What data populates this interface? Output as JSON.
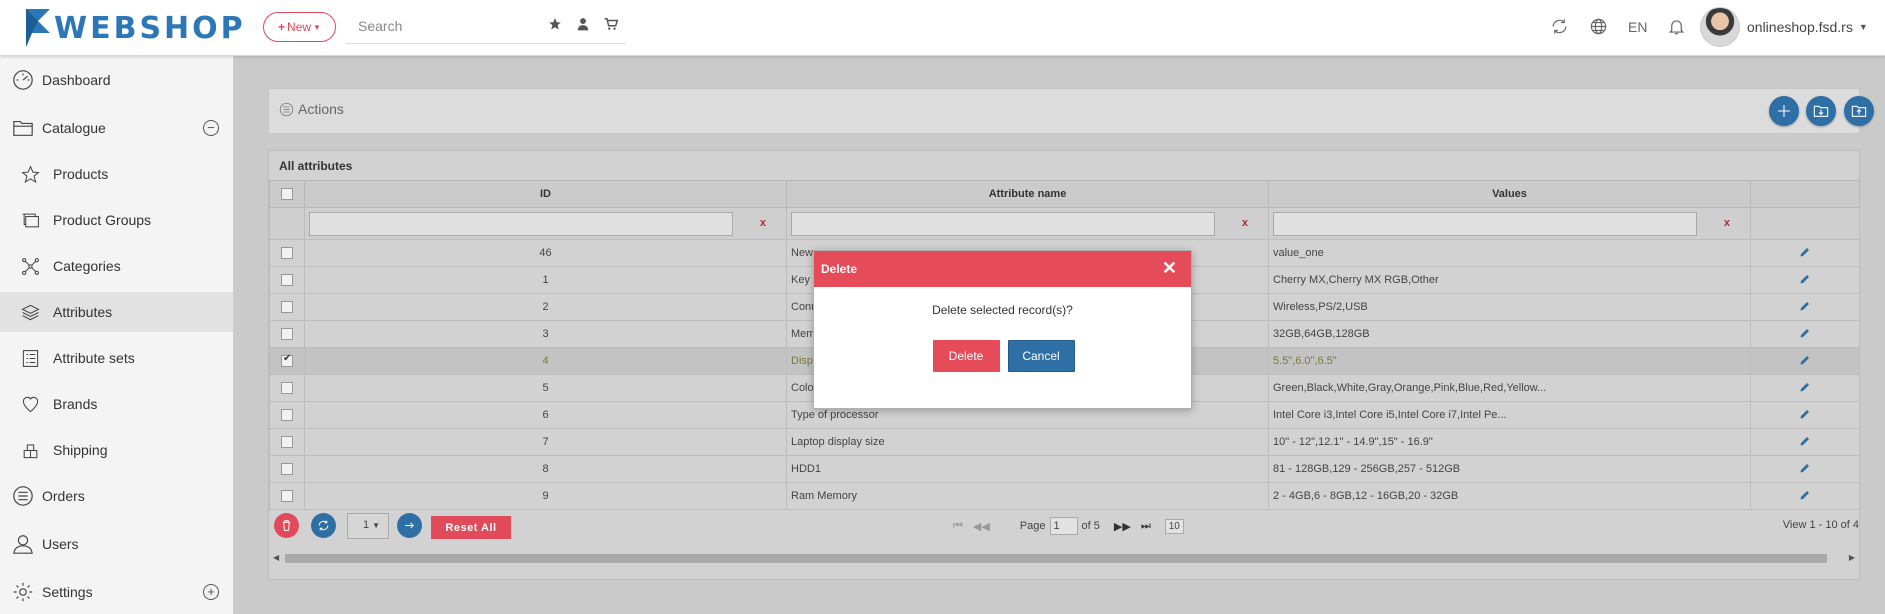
{
  "header": {
    "logo_text": "WEBSHOP",
    "new_button": "New",
    "search_placeholder": "Search",
    "language": "EN",
    "user_name": "onlineshop.fsd.rs"
  },
  "sidebar": {
    "items": [
      {
        "label": "Dashboard",
        "icon": "dashboard-icon"
      },
      {
        "label": "Catalogue",
        "icon": "folder-icon"
      },
      {
        "label": "Products",
        "icon": "star-icon"
      },
      {
        "label": "Product Groups",
        "icon": "groups-icon"
      },
      {
        "label": "Categories",
        "icon": "categories-icon"
      },
      {
        "label": "Attributes",
        "icon": "layers-icon"
      },
      {
        "label": "Attribute sets",
        "icon": "list-icon"
      },
      {
        "label": "Brands",
        "icon": "heart-icon"
      },
      {
        "label": "Shipping",
        "icon": "shipping-icon"
      },
      {
        "label": "Orders",
        "icon": "orders-icon"
      },
      {
        "label": "Users",
        "icon": "users-icon"
      },
      {
        "label": "Settings",
        "icon": "gear-icon"
      }
    ]
  },
  "actions": {
    "title": "Actions"
  },
  "grid": {
    "caption": "All attributes",
    "columns": [
      "ID",
      "Attribute name",
      "Values"
    ],
    "filter_clear": "x",
    "rows": [
      {
        "id": "46",
        "name": "New",
        "values": "value_one",
        "checked": false
      },
      {
        "id": "1",
        "name": "Key",
        "values": "Cherry MX,Cherry MX RGB,Other",
        "checked": false
      },
      {
        "id": "2",
        "name": "Conn",
        "values": "Wireless,PS/2,USB",
        "checked": false
      },
      {
        "id": "3",
        "name": "Mem",
        "values": "32GB,64GB,128GB",
        "checked": false
      },
      {
        "id": "4",
        "name": "Disp",
        "values": "5.5\",6.0\",6.5\"",
        "checked": true
      },
      {
        "id": "5",
        "name": "Colo",
        "values": "Green,Black,White,Gray,Orange,Pink,Blue,Red,Yellow...",
        "checked": false
      },
      {
        "id": "6",
        "name": "Type of processor",
        "values": "Intel Core i3,Intel Core i5,Intel Core i7,Intel Pe...",
        "checked": false
      },
      {
        "id": "7",
        "name": "Laptop display size",
        "values": "10\" - 12\",12.1\" - 14.9\",15\" - 16.9\"",
        "checked": false
      },
      {
        "id": "8",
        "name": "HDD1",
        "values": "81 - 128GB,129 - 256GB,257 - 512GB",
        "checked": false
      },
      {
        "id": "9",
        "name": "Ram Memory",
        "values": "2 - 4GB,6 - 8GB,12 - 16GB,20 - 32GB",
        "checked": false
      }
    ]
  },
  "pager": {
    "page_select": "1",
    "reset_label": "Reset All",
    "page_label": "Page",
    "page_value": "1",
    "of_label": "of 5",
    "rows_per_page": "10",
    "view_text": "View 1 - 10 of 4"
  },
  "modal": {
    "title": "Delete",
    "message": "Delete selected record(s)?",
    "delete_label": "Delete",
    "cancel_label": "Cancel"
  },
  "colors": {
    "accent_red": "#e64b5a",
    "accent_blue": "#2e6fa6",
    "logo_blue": "#2b77b8"
  }
}
